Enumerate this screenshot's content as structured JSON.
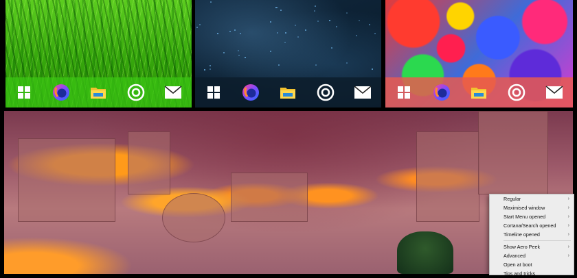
{
  "taskbar_icons": [
    "windows-start-icon",
    "firefox-icon",
    "file-explorer-folder-icon",
    "groove-music-icon",
    "mail-icon"
  ],
  "context_menu": {
    "items_top": [
      {
        "label": "Regular",
        "has_submenu": true
      },
      {
        "label": "Maximised window",
        "has_submenu": true
      },
      {
        "label": "Start Menu opened",
        "has_submenu": true
      },
      {
        "label": "Cortana/Search opened",
        "has_submenu": true
      },
      {
        "label": "Timeline opened",
        "has_submenu": true
      }
    ],
    "items_bottom": [
      {
        "label": "Show Aero Peek",
        "has_submenu": true
      },
      {
        "label": "Advanced",
        "has_submenu": true
      },
      {
        "label": "Open at boot",
        "has_submenu": false
      },
      {
        "label": "Tips and tricks",
        "has_submenu": false
      }
    ],
    "submenu_arrow": "›"
  },
  "colors": {
    "taskbar_green": "#3ac814",
    "taskbar_dark_blue": "#0c1e2c",
    "taskbar_red": "#e65a50",
    "menu_background": "#ededed"
  }
}
